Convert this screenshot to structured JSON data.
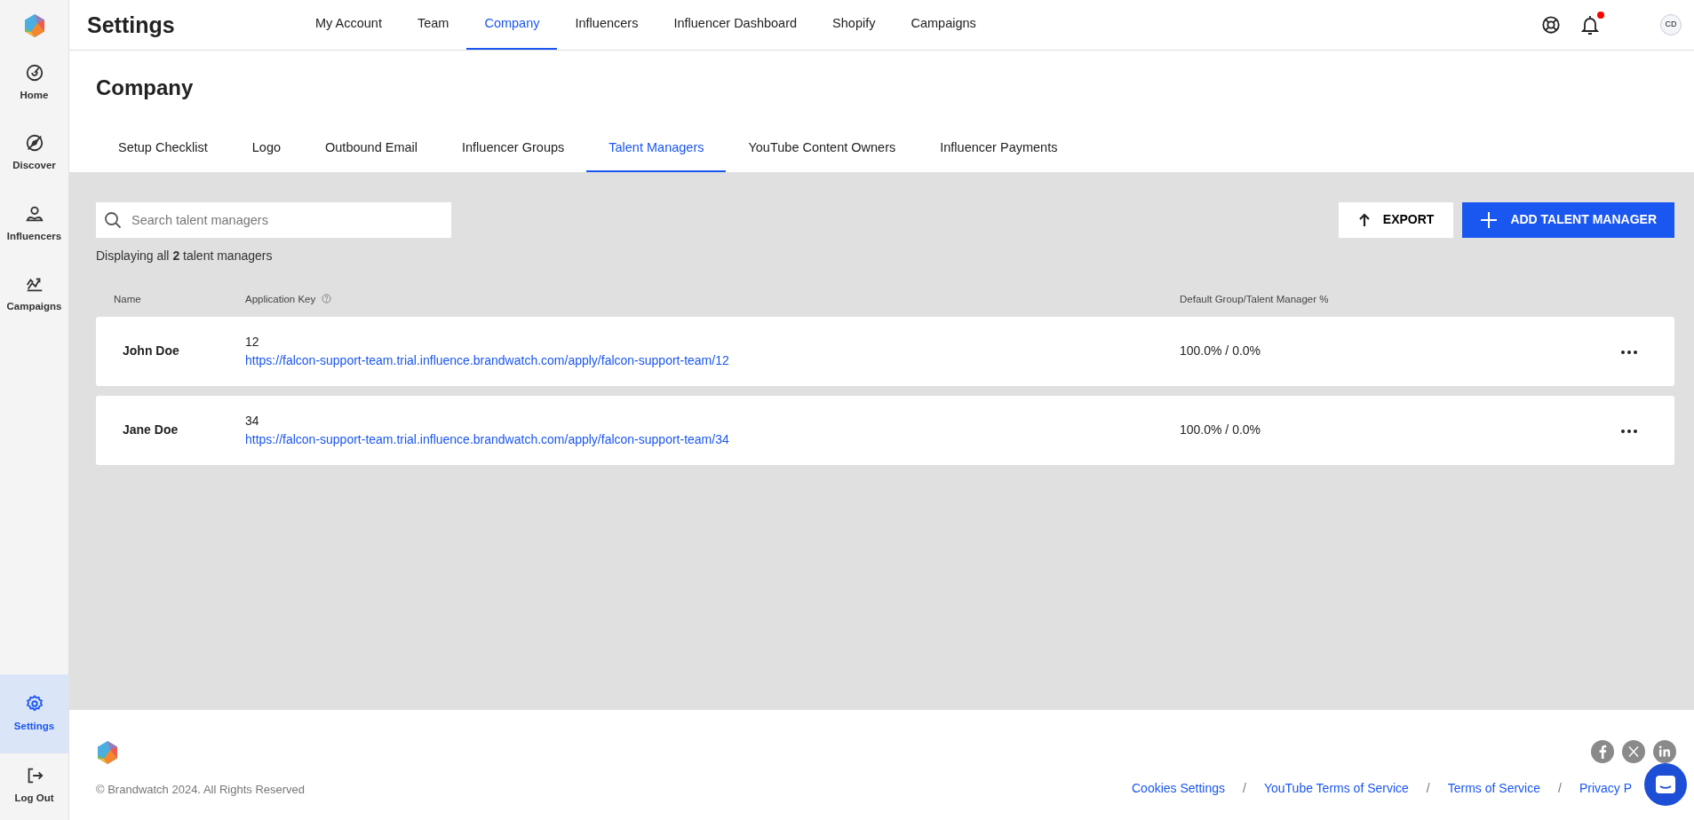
{
  "sidebar": {
    "items": [
      {
        "label": "Home",
        "selected": false
      },
      {
        "label": "Discover",
        "selected": false
      },
      {
        "label": "Influencers",
        "selected": false
      },
      {
        "label": "Campaigns",
        "selected": false
      }
    ],
    "bottom_items": [
      {
        "label": "Settings",
        "selected": true
      },
      {
        "label": "Log Out",
        "selected": false
      }
    ]
  },
  "header": {
    "title": "Settings",
    "nav": [
      {
        "label": "My Account",
        "selected": false
      },
      {
        "label": "Team",
        "selected": false
      },
      {
        "label": "Company",
        "selected": true
      },
      {
        "label": "Influencers",
        "selected": false
      },
      {
        "label": "Influencer Dashboard",
        "selected": false
      },
      {
        "label": "Shopify",
        "selected": false
      },
      {
        "label": "Campaigns",
        "selected": false
      }
    ],
    "notification_dot": true,
    "avatar": "CD"
  },
  "page": {
    "title": "Company",
    "tabs": [
      {
        "label": "Setup Checklist",
        "selected": false
      },
      {
        "label": "Logo",
        "selected": false
      },
      {
        "label": "Outbound Email",
        "selected": false
      },
      {
        "label": "Influencer Groups",
        "selected": false
      },
      {
        "label": "Talent Managers",
        "selected": true
      },
      {
        "label": "YouTube Content Owners",
        "selected": false
      },
      {
        "label": "Influencer Payments",
        "selected": false
      }
    ]
  },
  "search": {
    "placeholder": "Search talent managers"
  },
  "buttons": {
    "export": "EXPORT",
    "add": "ADD TALENT MANAGER"
  },
  "summary": "Displaying all **2** talent managers",
  "table": {
    "columns": [
      "Name",
      "Application Key",
      "Default Group/Talent Manager %"
    ],
    "rows": [
      {
        "name": "John Doe",
        "key": "12",
        "url": "https://falcon-support-team.trial.influence.brandwatch.com/apply/falcon-support-team/12",
        "split": "100.0% / 0.0%"
      },
      {
        "name": "Jane Doe",
        "key": "34",
        "url": "https://falcon-support-team.trial.influence.brandwatch.com/apply/falcon-support-team/34",
        "split": "100.0% / 0.0%"
      }
    ]
  },
  "footer": {
    "copyright": "© Brandwatch 2024. All Rights Reserved",
    "links": [
      "Cookies Settings",
      "YouTube Terms of Service",
      "Terms of Service",
      "Privacy P"
    ],
    "separator": "/"
  }
}
